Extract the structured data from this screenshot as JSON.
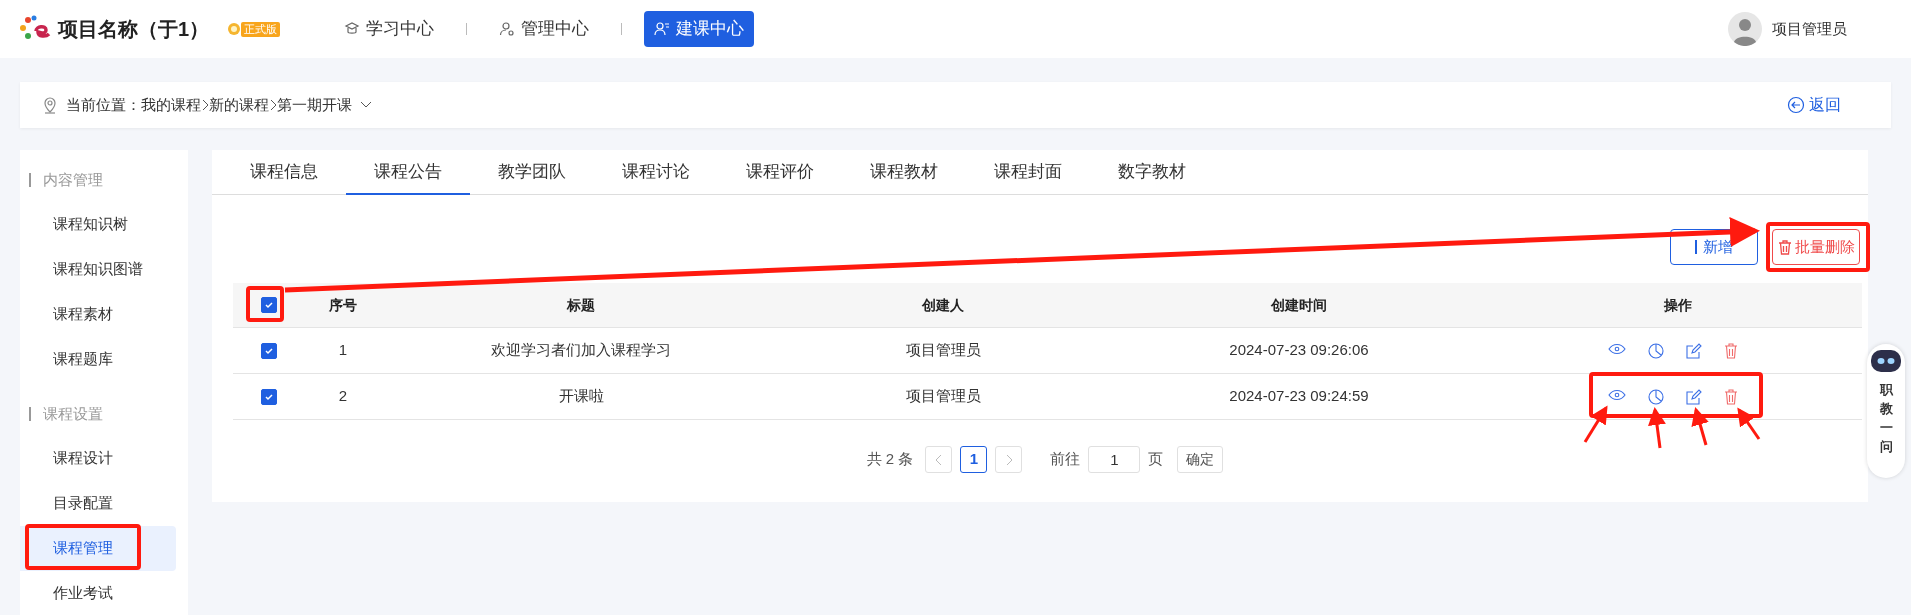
{
  "header": {
    "project_title": "项目名称（于1）",
    "edition_badge": "正式版",
    "nav": [
      {
        "label": "学习中心",
        "selected": false,
        "kind": "learn"
      },
      {
        "label": "管理中心",
        "selected": false,
        "kind": "manage"
      },
      {
        "label": "建课中心",
        "selected": true,
        "kind": "build"
      }
    ],
    "user_name": "项目管理员"
  },
  "breadcrumb": {
    "prefix": "当前位置：",
    "items": [
      "我的课程",
      "新的课程",
      "第一期开课"
    ],
    "back": "返回"
  },
  "sidebar": {
    "groups": [
      {
        "title": "内容管理",
        "items": [
          {
            "label": "课程知识树",
            "selected": false
          },
          {
            "label": "课程知识图谱",
            "selected": false
          },
          {
            "label": "课程素材",
            "selected": false
          },
          {
            "label": "课程题库",
            "selected": false
          }
        ]
      },
      {
        "title": "课程设置",
        "items": [
          {
            "label": "课程设计",
            "selected": false
          },
          {
            "label": "目录配置",
            "selected": false
          },
          {
            "label": "课程管理",
            "selected": true
          },
          {
            "label": "作业考试",
            "selected": false
          }
        ]
      }
    ]
  },
  "tabs": [
    {
      "label": "课程信息",
      "selected": false
    },
    {
      "label": "课程公告",
      "selected": true
    },
    {
      "label": "教学团队",
      "selected": false
    },
    {
      "label": "课程讨论",
      "selected": false
    },
    {
      "label": "课程评价",
      "selected": false
    },
    {
      "label": "课程教材",
      "selected": false
    },
    {
      "label": "课程封面",
      "selected": false
    },
    {
      "label": "数字教材",
      "selected": false
    }
  ],
  "toolbar": {
    "add": "新增",
    "batch_delete": "批量删除"
  },
  "table": {
    "all_checked": true,
    "columns": [
      "序号",
      "标题",
      "创建人",
      "创建时间",
      "操作"
    ],
    "rows": [
      {
        "checked": true,
        "index": "1",
        "title": "欢迎学习者们加入课程学习",
        "creator": "项目管理员",
        "created": "2024-07-23 09:26:06"
      },
      {
        "checked": true,
        "index": "2",
        "title": "开课啦",
        "creator": "项目管理员",
        "created": "2024-07-23 09:24:59"
      }
    ]
  },
  "pagination": {
    "total": "共 2 条",
    "pages": [
      {
        "label": "1",
        "selected": true
      }
    ],
    "goto": "前往",
    "page_value": "1",
    "page_unit": "页",
    "confirm": "确定"
  },
  "assistant": {
    "label": [
      "职",
      "教",
      "一",
      "问"
    ]
  }
}
